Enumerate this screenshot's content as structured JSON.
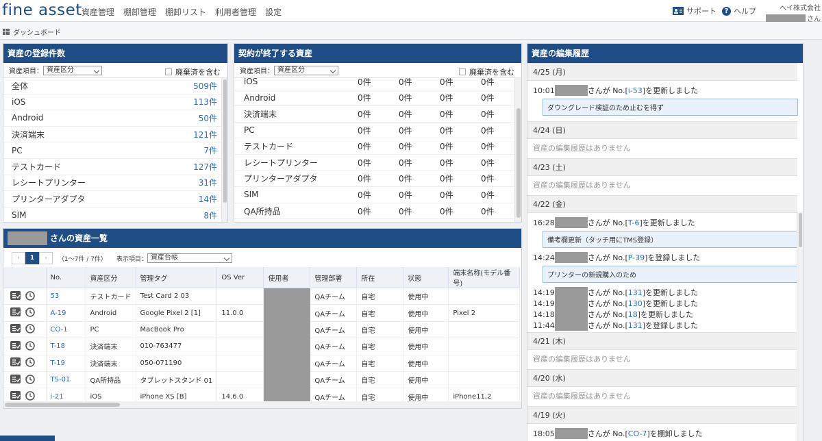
{
  "header": {
    "logo": "fine asset",
    "nav": [
      "資産管理",
      "棚卸管理",
      "棚卸リスト",
      "利用者管理",
      "設定"
    ],
    "support": "サポート",
    "help": "ヘルプ",
    "company": "ヘイ株式会社",
    "user_suffix": "さん"
  },
  "breadcrumb": "ダッシュボード",
  "registered": {
    "title": "資産の登録件数",
    "filter_label": "資産項目：",
    "filter_value": "資産区分",
    "checkbox_label": "廃棄済を含む",
    "rows": [
      {
        "label": "全体",
        "value": "509件"
      },
      {
        "label": "iOS",
        "value": "113件"
      },
      {
        "label": "Android",
        "value": "50件"
      },
      {
        "label": "決済端末",
        "value": "121件"
      },
      {
        "label": "PC",
        "value": "7件"
      },
      {
        "label": "テストカード",
        "value": "127件"
      },
      {
        "label": "レシートプリンター",
        "value": "31件"
      },
      {
        "label": "プリンターアダプタ",
        "value": "14件"
      },
      {
        "label": "SIM",
        "value": "8件"
      }
    ]
  },
  "contract": {
    "title": "契約が終了する資産",
    "filter_label": "資産項目：",
    "filter_value": "資産区分",
    "checkbox_label": "廃棄済を含む",
    "rows": [
      {
        "label": "iOS",
        "c": [
          "0件",
          "0件",
          "0件",
          "0件"
        ]
      },
      {
        "label": "Android",
        "c": [
          "0件",
          "0件",
          "0件",
          "0件"
        ]
      },
      {
        "label": "決済端末",
        "c": [
          "0件",
          "0件",
          "0件",
          "0件"
        ]
      },
      {
        "label": "PC",
        "c": [
          "0件",
          "0件",
          "0件",
          "0件"
        ]
      },
      {
        "label": "テストカード",
        "c": [
          "0件",
          "0件",
          "0件",
          "0件"
        ]
      },
      {
        "label": "レシートプリンター",
        "c": [
          "0件",
          "0件",
          "0件",
          "0件"
        ]
      },
      {
        "label": "プリンターアダプタ",
        "c": [
          "0件",
          "0件",
          "0件",
          "0件"
        ]
      },
      {
        "label": "SIM",
        "c": [
          "0件",
          "0件",
          "0件",
          "0件"
        ]
      },
      {
        "label": "QA所持品",
        "c": [
          "0件",
          "0件",
          "0件",
          "0件"
        ]
      }
    ]
  },
  "assets": {
    "title_suffix": "さんの資産一覧",
    "page": "1",
    "range": "（1〜7件 / 7件）",
    "display_label": "表示項目：",
    "display_value": "資産台帳",
    "columns": [
      "No.",
      "資産区分",
      "管理タグ",
      "OS Ver",
      "使用者",
      "管理部署",
      "所在",
      "状態",
      "端末名称(モデル番号)"
    ],
    "rows": [
      {
        "no": "53",
        "cat": "テストカード",
        "tag": "Test Card 2 03",
        "os": "",
        "dept": "QAチーム",
        "loc": "自宅",
        "status": "使用中",
        "model": ""
      },
      {
        "no": "A-19",
        "cat": "Android",
        "tag": "Google Pixel 2 [1]",
        "os": "11.0.0",
        "dept": "QAチーム",
        "loc": "自宅",
        "status": "使用中",
        "model": "Pixel 2"
      },
      {
        "no": "CO-1",
        "cat": "PC",
        "tag": "MacBook Pro",
        "os": "",
        "dept": "QAチーム",
        "loc": "自宅",
        "status": "使用中",
        "model": ""
      },
      {
        "no": "T-18",
        "cat": "決済端末",
        "tag": "010-763477",
        "os": "",
        "dept": "QAチーム",
        "loc": "自宅",
        "status": "使用中",
        "model": ""
      },
      {
        "no": "T-19",
        "cat": "決済端末",
        "tag": "050-071190",
        "os": "",
        "dept": "QAチーム",
        "loc": "自宅",
        "status": "使用中",
        "model": ""
      },
      {
        "no": "TS-01",
        "cat": "QA所持品",
        "tag": "タブレットスタンド 01",
        "os": "",
        "dept": "QAチーム",
        "loc": "自宅",
        "status": "使用中",
        "model": ""
      },
      {
        "no": "i-21",
        "cat": "iOS",
        "tag": "iPhone XS [B]",
        "os": "14.6.0",
        "dept": "QAチーム",
        "loc": "自宅",
        "status": "使用中",
        "model": "iPhone11,2"
      }
    ]
  },
  "history": {
    "title": "資産の編集履歴",
    "none_text": "資産の編集履歴はありません",
    "days": [
      {
        "date": "4/25 (月)",
        "entries": [
          {
            "time": "10:01",
            "mid": "さんが No.[",
            "link": "i-53",
            "end": "]を更新しました",
            "note": "ダウングレード検証のため止むを得ず"
          }
        ]
      },
      {
        "date": "4/24 (日)",
        "entries": []
      },
      {
        "date": "4/23 (土)",
        "entries": []
      },
      {
        "date": "4/22 (金)",
        "entries": [
          {
            "time": "16:28",
            "mid": "さんが No.[",
            "link": "T-6",
            "end": "]を更新しました",
            "note": "備考欄更新（タッチ用にTMS登録）"
          },
          {
            "time": "14:24",
            "mid": "さんが No.[",
            "link": "P-39",
            "end": "]を登録しました",
            "note": "プリンターの新規購入のため"
          },
          {
            "time": "14:19",
            "mid": "さんが No.[",
            "link": "131",
            "end": "]を更新しました",
            "note": ""
          },
          {
            "time": "14:19",
            "mid": "さんが No.[",
            "link": "130",
            "end": "]を更新しました",
            "note": ""
          },
          {
            "time": "14:18",
            "mid": "さんが No.[",
            "link": "18",
            "end": "]を更新しました",
            "note": ""
          },
          {
            "time": "11:44",
            "mid": "さんが No.[",
            "link": "131",
            "end": "]を登録しました",
            "note": ""
          }
        ]
      },
      {
        "date": "4/21 (木)",
        "entries": []
      },
      {
        "date": "4/20 (水)",
        "entries": []
      },
      {
        "date": "4/19 (火)",
        "entries": [
          {
            "time": "18:05",
            "mid": "さんが No.[",
            "link": "CO-7",
            "end": "]を棚卸しました",
            "note": ""
          }
        ]
      }
    ]
  }
}
